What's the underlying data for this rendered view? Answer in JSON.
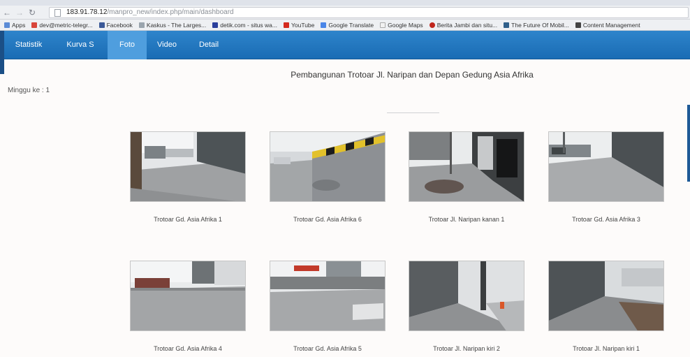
{
  "browser": {
    "url_host": "183.91.78.12",
    "url_path": "/manpro_new/index.php/main/dashboard",
    "bookmarks": [
      "Apps",
      "dev@metric-telegr...",
      "Facebook",
      "Kaskus - The Larges...",
      "detik.com - situs wa...",
      "YouTube",
      "Google Translate",
      "Google Maps",
      "Berita Jambi dan situ...",
      "The Future Of Mobil...",
      "Content Management"
    ]
  },
  "nav": {
    "tabs": [
      {
        "label": "Statistik",
        "active": false
      },
      {
        "label": "Kurva S",
        "active": false
      },
      {
        "label": "Foto",
        "active": true
      },
      {
        "label": "Video",
        "active": false
      },
      {
        "label": "Detail",
        "active": false
      }
    ]
  },
  "page": {
    "title": "Pembangunan Trotoar Jl. Naripan dan Depan Gedung Asia Afrika",
    "minggu": "Minggu ke : 1"
  },
  "photos": [
    {
      "caption": "Trotoar Gd. Asia Afrika 1"
    },
    {
      "caption": "Trotoar Gd. Asia Afrika 6"
    },
    {
      "caption": "Trotoar Jl. Naripan kanan 1"
    },
    {
      "caption": "Trotoar Gd. Asia Afrika 3"
    },
    {
      "caption": "Trotoar Gd. Asia Afrika 4"
    },
    {
      "caption": "Trotoar Gd. Asia Afrika 5"
    },
    {
      "caption": "Trotoar Jl. Naripan kiri 2"
    },
    {
      "caption": "Trotoar Jl. Naripan kiri 1"
    }
  ]
}
